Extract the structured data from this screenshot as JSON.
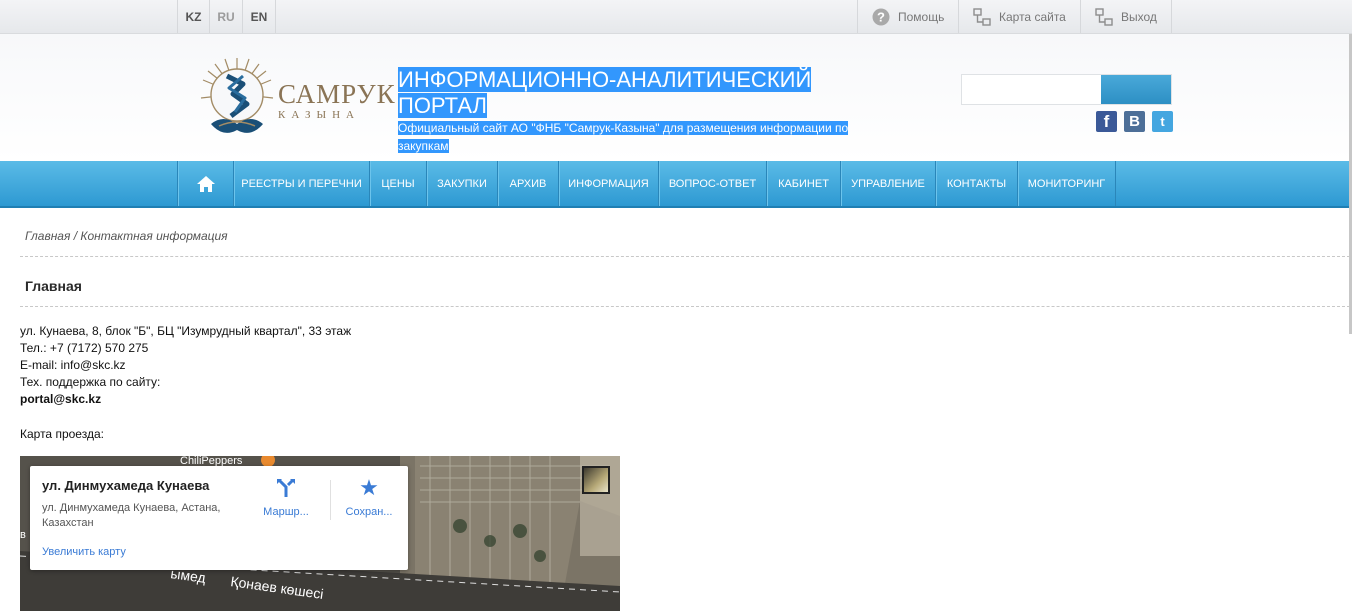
{
  "languages": [
    {
      "code": "KZ"
    },
    {
      "code": "RU"
    },
    {
      "code": "EN"
    }
  ],
  "top_links": {
    "help": "Помощь",
    "sitemap": "Карта сайта",
    "logout": "Выход"
  },
  "logo": {
    "line1": "САМРУК",
    "line2": "КАЗЫНА"
  },
  "header": {
    "title": "ИНФОРМАЦИОННО-АНАЛИТИЧЕСКИЙ ПОРТАЛ",
    "subtitle": "Официальный сайт АО \"ФНБ \"Самрук-Казына\" для размещения информации по закупкам"
  },
  "search": {
    "placeholder": ""
  },
  "social": {
    "fb": "f",
    "vk": "B",
    "tw": "t"
  },
  "nav": {
    "items": [
      "РЕЕСТРЫ И ПЕРЕЧНИ",
      "ЦЕНЫ",
      "ЗАКУПКИ",
      "АРХИВ",
      "ИНФОРМАЦИЯ",
      "ВОПРОС-ОТВЕТ",
      "КАБИНЕТ",
      "УПРАВЛЕНИЕ",
      "КОНТАКТЫ",
      "МОНИТОРИНГ"
    ]
  },
  "breadcrumb": "Главная / Контактная информация",
  "section_title": "Главная",
  "contacts": {
    "address": "ул. Кунаева, 8, блок \"Б\", БЦ \"Изумрудный квартал\", 33 этаж",
    "phone": "Тел.: +7 (7172) 570 275",
    "email": "E-mail: info@skc.kz",
    "support_label": "Тех. поддержка по сайту:",
    "support_email": "portal@skc.kz"
  },
  "map": {
    "label": "Карта проезда:",
    "place_name": "ул. Динмухамеда Кунаева",
    "place_address": "ул. Динмухамеда Кунаева, Астана, Казахстан",
    "enlarge": "Увеличить карту",
    "route": "Маршр...",
    "save": "Сохран...",
    "poi": "ChiliPeppers",
    "street": "Қонаев көшесі",
    "street_fragment": "ымед",
    "edge_letter": "в"
  }
}
